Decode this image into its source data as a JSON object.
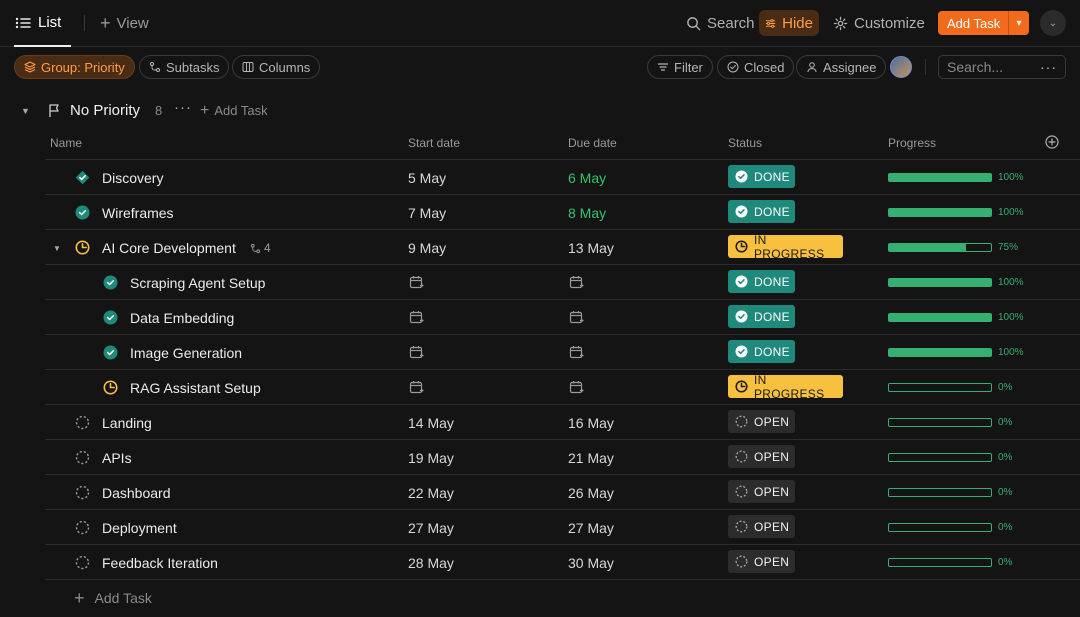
{
  "topbar": {
    "tab_label": "List",
    "add_view_label": "View",
    "search_label": "Search",
    "hide_label": "Hide",
    "customize_label": "Customize",
    "add_task_label": "Add Task"
  },
  "filterbar": {
    "group_label": "Group: Priority",
    "subtasks_label": "Subtasks",
    "columns_label": "Columns",
    "filter_label": "Filter",
    "closed_label": "Closed",
    "assignee_label": "Assignee",
    "search_placeholder": "Search..."
  },
  "group": {
    "title": "No Priority",
    "count": "8",
    "add_task_label": "Add Task"
  },
  "columns": {
    "name": "Name",
    "start": "Start date",
    "due": "Due date",
    "status": "Status",
    "progress": "Progress"
  },
  "tasks": [
    {
      "name": "Discovery",
      "start": "5 May",
      "due": "6 May",
      "due_green": true,
      "status": "DONE",
      "status_type": "done",
      "progress": 100,
      "progress_label": "100%",
      "icon": "done-diamond-icon",
      "level": 0
    },
    {
      "name": "Wireframes",
      "start": "7 May",
      "due": "8 May",
      "due_green": true,
      "status": "DONE",
      "status_type": "done",
      "progress": 100,
      "progress_label": "100%",
      "icon": "done-icon",
      "level": 0
    },
    {
      "name": "AI Core Development",
      "start": "9 May",
      "due": "13 May",
      "due_green": false,
      "status": "IN PROGRESS",
      "status_type": "inprog",
      "progress": 75,
      "progress_label": "75%",
      "icon": "in-progress-icon",
      "level": 0,
      "expanded": true,
      "subtask_count": "4"
    },
    {
      "name": "Scraping Agent Setup",
      "start": "",
      "due": "",
      "status": "DONE",
      "status_type": "done",
      "progress": 100,
      "progress_label": "100%",
      "icon": "done-icon",
      "level": 1
    },
    {
      "name": "Data Embedding",
      "start": "",
      "due": "",
      "status": "DONE",
      "status_type": "done",
      "progress": 100,
      "progress_label": "100%",
      "icon": "done-icon",
      "level": 1
    },
    {
      "name": "Image Generation",
      "start": "",
      "due": "",
      "status": "DONE",
      "status_type": "done",
      "progress": 100,
      "progress_label": "100%",
      "icon": "done-icon",
      "level": 1
    },
    {
      "name": "RAG Assistant Setup",
      "start": "",
      "due": "",
      "status": "IN PROGRESS",
      "status_type": "inprog",
      "progress": 0,
      "progress_label": "0%",
      "icon": "in-progress-icon",
      "level": 1
    },
    {
      "name": "Landing",
      "start": "14 May",
      "due": "16 May",
      "due_green": false,
      "status": "OPEN",
      "status_type": "open",
      "progress": 0,
      "progress_label": "0%",
      "icon": "open-icon",
      "level": 0
    },
    {
      "name": "APIs",
      "start": "19 May",
      "due": "21 May",
      "due_green": false,
      "status": "OPEN",
      "status_type": "open",
      "progress": 0,
      "progress_label": "0%",
      "icon": "open-icon",
      "level": 0
    },
    {
      "name": "Dashboard",
      "start": "22 May",
      "due": "26 May",
      "due_green": false,
      "status": "OPEN",
      "status_type": "open",
      "progress": 0,
      "progress_label": "0%",
      "icon": "open-icon",
      "level": 0
    },
    {
      "name": "Deployment",
      "start": "27 May",
      "due": "27 May",
      "due_green": false,
      "status": "OPEN",
      "status_type": "open",
      "progress": 0,
      "progress_label": "0%",
      "icon": "open-icon",
      "level": 0
    },
    {
      "name": "Feedback Iteration",
      "start": "28 May",
      "due": "30 May",
      "due_green": false,
      "status": "OPEN",
      "status_type": "open",
      "progress": 0,
      "progress_label": "0%",
      "icon": "open-icon",
      "level": 0
    }
  ],
  "footer": {
    "add_task_label": "Add Task"
  },
  "colors": {
    "accent": "#f26b1d",
    "done": "#1f8a7c",
    "in_progress": "#f7c13f",
    "progress": "#36b071",
    "due_green": "#35c46c"
  }
}
